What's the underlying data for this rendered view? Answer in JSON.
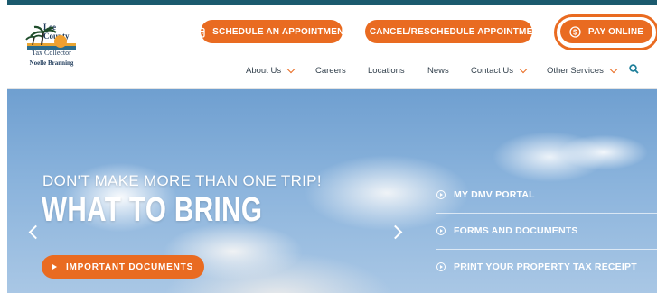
{
  "logo": {
    "arc_text": "Lee County",
    "line1": "Tax Collector",
    "line2": "Noelle Branning"
  },
  "header_buttons": {
    "schedule": "SCHEDULE AN APPOINTMENT",
    "cancel": "CANCEL/RESCHEDULE APPOINTMENT",
    "pay": "PAY ONLINE"
  },
  "nav": {
    "about": "About Us",
    "careers": "Careers",
    "locations": "Locations",
    "news": "News",
    "contact": "Contact Us",
    "other": "Other Services"
  },
  "hero": {
    "subtitle": "DON'T MAKE MORE THAN ONE TRIP!",
    "title": "WHAT TO BRING",
    "button": "IMPORTANT DOCUMENTS",
    "links": [
      "MY DMV PORTAL",
      "FORMS AND DOCUMENTS",
      "PRINT YOUR PROPERTY TAX RECEIPT"
    ]
  },
  "colors": {
    "accent": "#e96b21",
    "topbar": "#1b5a6e",
    "nav_text": "#33414d",
    "search": "#1f7f9a"
  },
  "icons": [
    "calendar-icon",
    "close-icon",
    "dollar-icon",
    "search-icon",
    "chevron-down-icon",
    "play-icon"
  ]
}
